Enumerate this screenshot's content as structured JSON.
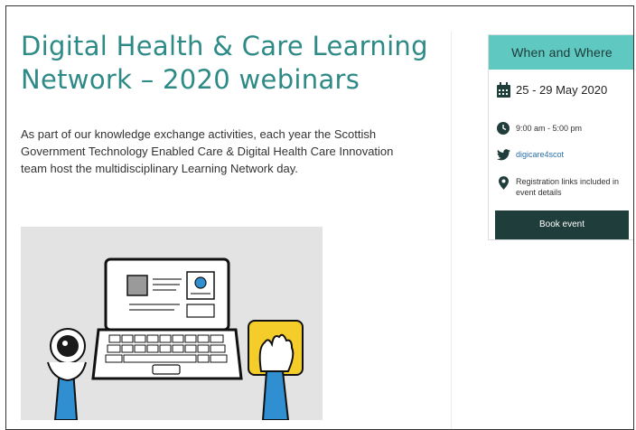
{
  "article": {
    "title": "Digital Health & Care Learning Network – 2020 webinars",
    "intro": "As part of our knowledge exchange activities, each year the Scottish Government Technology Enabled Care & Digital Health Care Innovation team host the multidisciplinary Learning Network day."
  },
  "event_card": {
    "heading": "When and Where",
    "date": "25 - 29 May 2020",
    "time": "9:00 am - 5:00 pm",
    "twitter_handle": "digicare4scot",
    "location": "Registration links included in event details",
    "book_label": "Book event"
  },
  "colors": {
    "title_teal": "#2e8a86",
    "card_header": "#5fc9c1",
    "button_dark": "#1f3d3a",
    "accent_yellow": "#f5cd2a",
    "accent_blue": "#2f8fd0"
  }
}
